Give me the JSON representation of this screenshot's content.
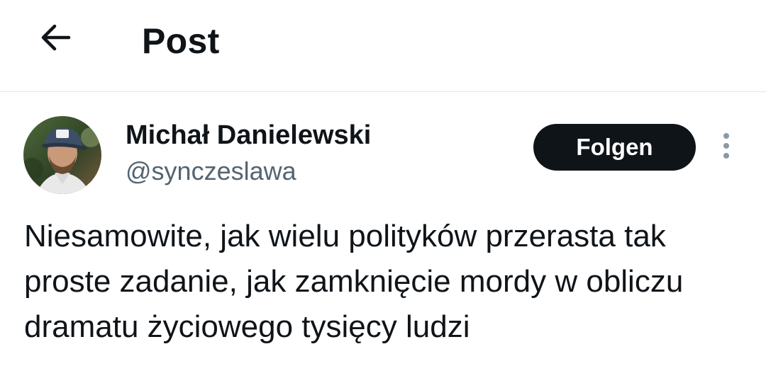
{
  "header": {
    "back_icon": "arrow-left-icon",
    "title": "Post"
  },
  "post": {
    "author": {
      "name": "Michał Danielewski",
      "handle": "@synczeslawa",
      "avatar_icon": "profile-photo"
    },
    "follow_label": "Folgen",
    "more_icon": "vertical-ellipsis-icon",
    "text": "Niesamowite, jak wielu polityków przerasta tak proste zadanie, jak zamknięcie mordy w obliczu dramatu życiowego tysięcy ludzi"
  },
  "colors": {
    "text": "#0f1419",
    "secondary_text": "#536471",
    "follow_button_bg": "#0f1419",
    "follow_button_text": "#ffffff",
    "divider": "#e1e4e8"
  }
}
